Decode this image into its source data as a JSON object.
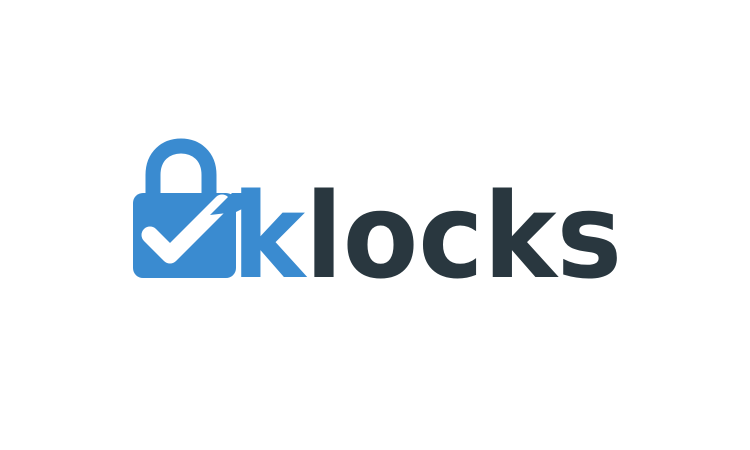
{
  "logo": {
    "wordmark": "klocks",
    "colors": {
      "icon_blue": "#3a8bd0",
      "text_dark": "#29373f",
      "background": "#ffffff"
    },
    "icons": {
      "padlock": "padlock-icon",
      "check": "checkmark-icon"
    }
  }
}
